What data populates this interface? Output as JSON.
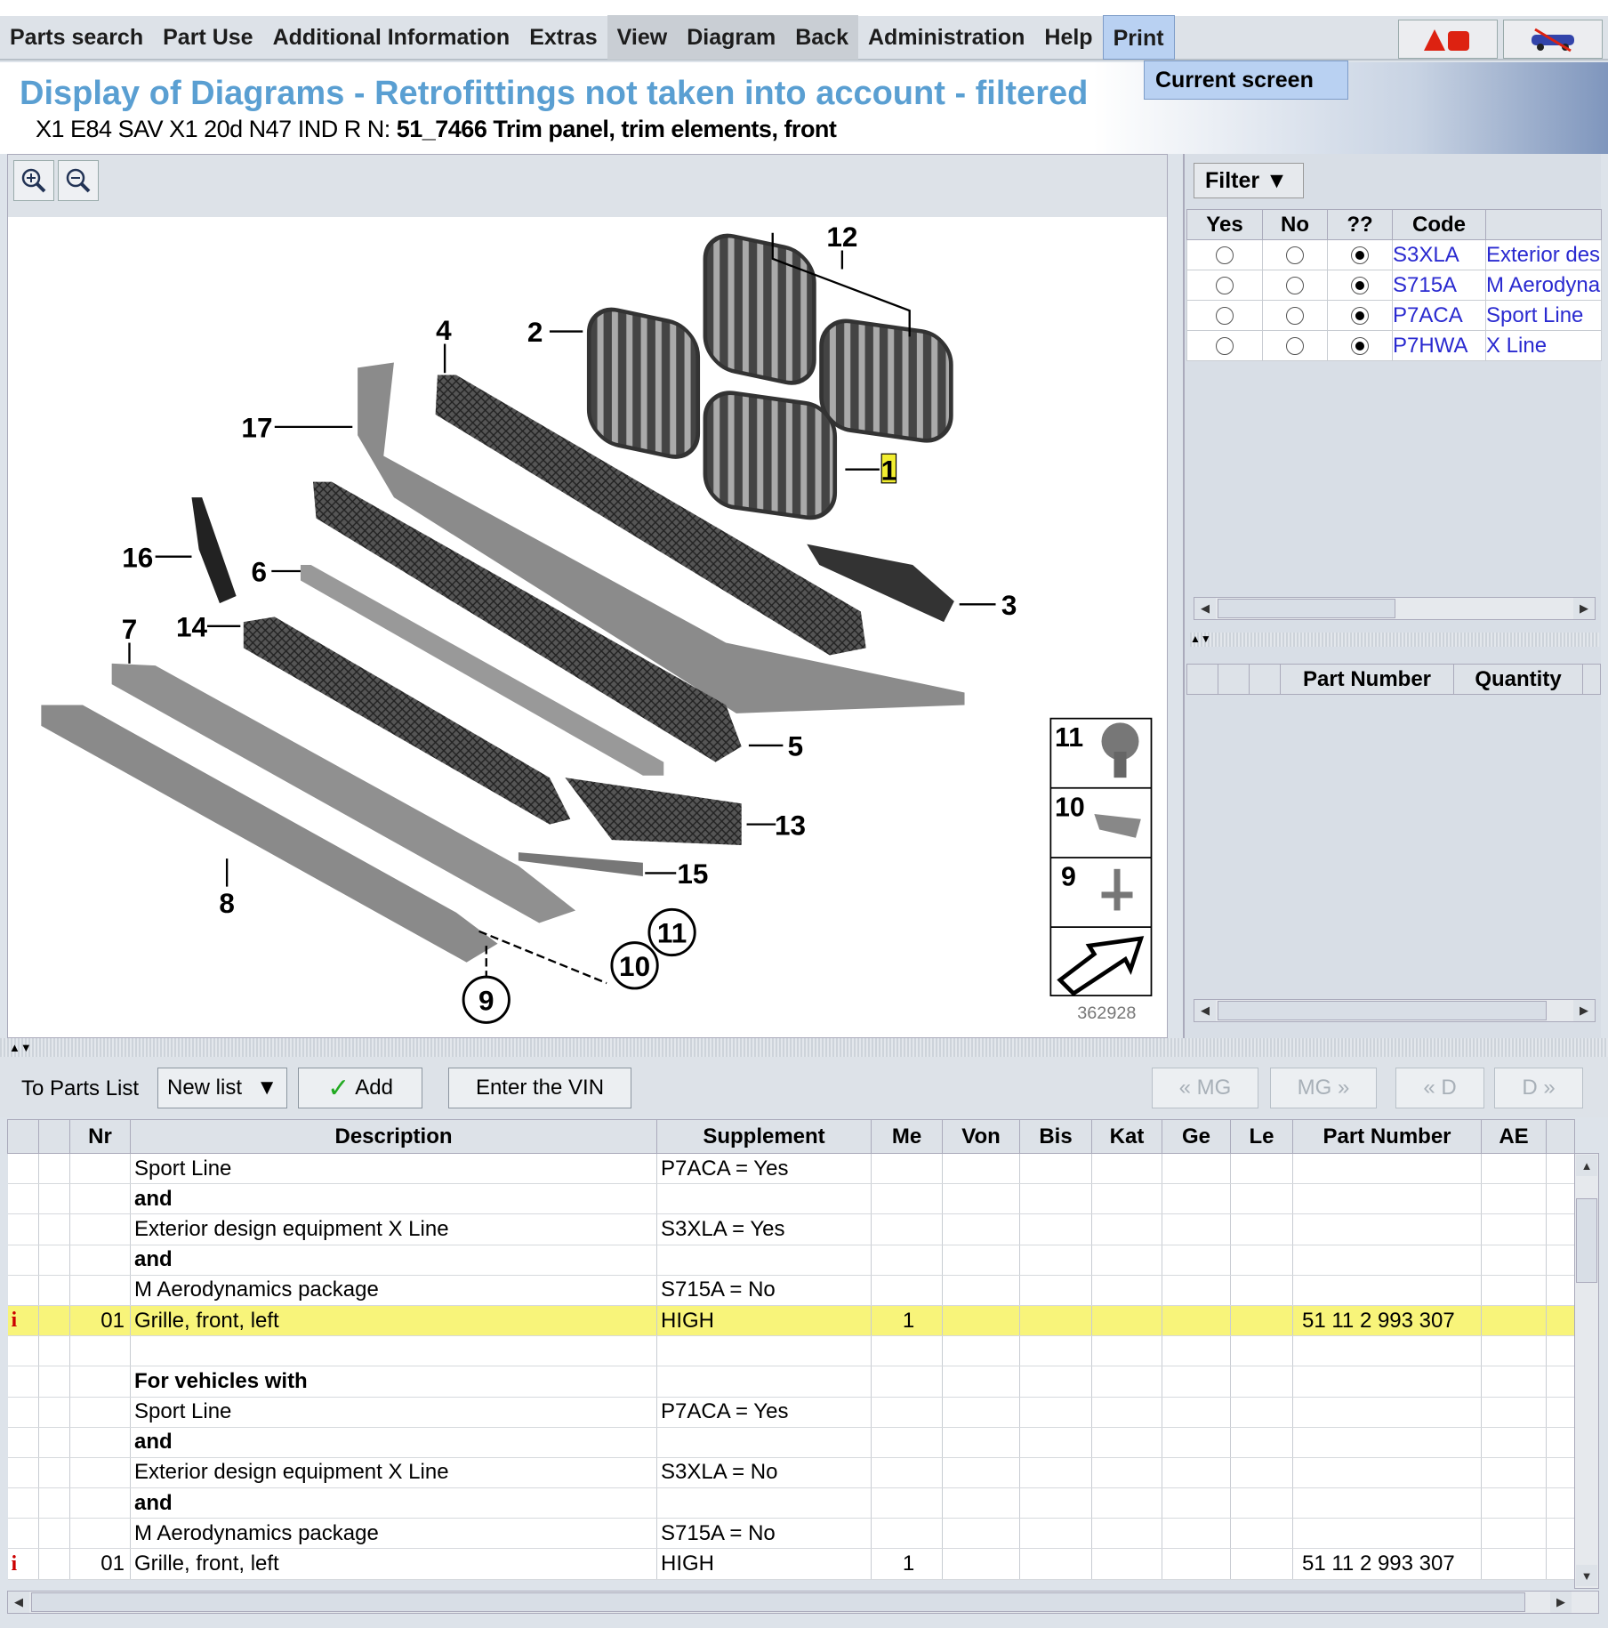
{
  "menu": [
    "Parts search",
    "Part Use",
    "Additional Information",
    "Extras",
    "View",
    "Diagram",
    "Back",
    "Administration",
    "Help",
    "Print"
  ],
  "print_menu": {
    "item": "Current screen"
  },
  "header": {
    "title": "Display of Diagrams - Retrofittings not taken into account - filtered",
    "vehicle": "X1 E84 SAV X1 20d N47 IND  R N:",
    "group": "51_7466 Trim panel, trim elements, front"
  },
  "diagram": {
    "image_number": "362928",
    "labels": [
      "12",
      "2",
      "4",
      "17",
      "1",
      "16",
      "6",
      "3",
      "7",
      "14",
      "5",
      "13",
      "15",
      "8",
      "11",
      "10",
      "9"
    ],
    "inset_labels": [
      "11",
      "10",
      "9"
    ]
  },
  "filter": {
    "button": "Filter",
    "columns": [
      "Yes",
      "No",
      "??",
      "Code",
      ""
    ],
    "rows": [
      {
        "code": "S3XLA",
        "desc": "Exterior design equipment X Line",
        "sel": "??"
      },
      {
        "code": "S715A",
        "desc": "M Aerodynamics package",
        "sel": "??"
      },
      {
        "code": "P7ACA",
        "desc": "Sport Line",
        "sel": "??"
      },
      {
        "code": "P7HWA",
        "desc": "X Line",
        "sel": "??"
      }
    ]
  },
  "selection_table": {
    "columns": [
      "",
      "",
      "",
      "Part Number",
      "Quantity"
    ]
  },
  "toolbar": {
    "to_parts_list": "To Parts List",
    "list_select": "New list",
    "add": "Add",
    "enter_vin": "Enter the VIN",
    "prev_mg": "« MG",
    "next_mg": "MG »",
    "prev_d": "« D",
    "next_d": "D »"
  },
  "parts": {
    "columns": [
      "",
      "",
      "Nr",
      "Description",
      "Supplement",
      "Me",
      "Von",
      "Bis",
      "Kat",
      "Ge",
      "Le",
      "Part Number",
      "AE",
      ""
    ],
    "rows": [
      {
        "desc": "Sport Line",
        "supp": "P7ACA = Yes"
      },
      {
        "desc": "and",
        "bold": true
      },
      {
        "desc": "Exterior design equipment X Line",
        "supp": "S3XLA = Yes"
      },
      {
        "desc": "and",
        "bold": true
      },
      {
        "desc": "M Aerodynamics package",
        "supp": "S715A = No"
      },
      {
        "info": "i",
        "nr": "01",
        "desc": "Grille, front, left",
        "supp": "HIGH",
        "me": "1",
        "pn": "51 11 2 993 307",
        "hl": true
      },
      {
        "desc": ""
      },
      {
        "desc": "For vehicles with",
        "bold": true
      },
      {
        "desc": "Sport Line",
        "supp": "P7ACA = Yes"
      },
      {
        "desc": "and",
        "bold": true
      },
      {
        "desc": "Exterior design equipment X Line",
        "supp": "S3XLA = No"
      },
      {
        "desc": "and",
        "bold": true
      },
      {
        "desc": "M Aerodynamics package",
        "supp": "S715A = No"
      },
      {
        "info": "i",
        "nr": "01",
        "desc": "Grille, front, left",
        "supp": "HIGH",
        "me": "1",
        "pn": "51 11 2 993 307"
      }
    ]
  },
  "colors": {
    "title": "#5a9fd2",
    "highlight": "#f8f47a",
    "link": "#2a2ad0"
  }
}
